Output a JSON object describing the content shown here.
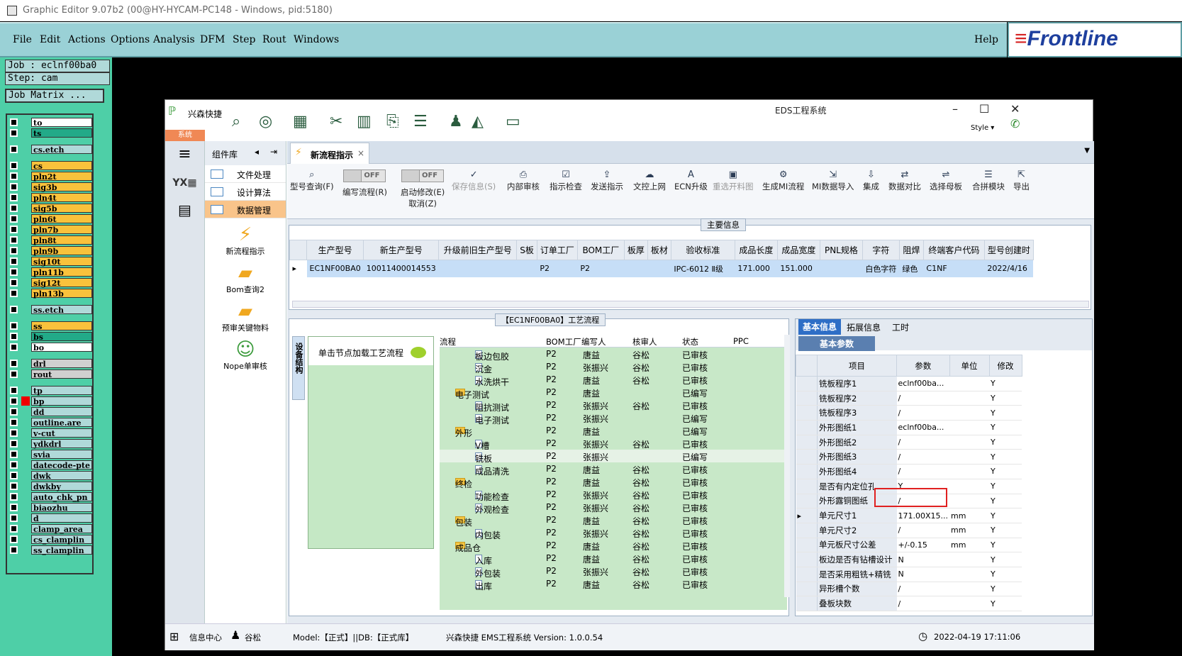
{
  "outer": {
    "title": "Graphic Editor 9.07b2 (00@HY-HYCAM-PC148 - Windows, pid:5180)",
    "menu": [
      "File",
      "Edit",
      "Actions",
      "Options",
      "Analysis",
      "DFM",
      "Step",
      "Rout",
      "Windows"
    ],
    "help": "Help",
    "logo": "Frontline",
    "job": "Job : eclnf00ba0",
    "step": "Step: cam",
    "job_matrix": "Job Matrix ...",
    "layers": [
      {
        "name": "to",
        "color": "#ffffff"
      },
      {
        "name": "ts",
        "color": "#22aa88"
      },
      {
        "name": "cs.etch",
        "color": "#b0d9d9"
      },
      {
        "name": "cs",
        "color": "#f9c23c"
      },
      {
        "name": "pln2t",
        "color": "#f9c23c"
      },
      {
        "name": "sig3b",
        "color": "#f9c23c"
      },
      {
        "name": "pln4t",
        "color": "#f9c23c"
      },
      {
        "name": "sig5b",
        "color": "#f9c23c"
      },
      {
        "name": "pln6t",
        "color": "#f9c23c"
      },
      {
        "name": "pln7b",
        "color": "#f9c23c"
      },
      {
        "name": "pln8t",
        "color": "#f9c23c"
      },
      {
        "name": "pln9b",
        "color": "#f9c23c"
      },
      {
        "name": "sig10t",
        "color": "#f9c23c"
      },
      {
        "name": "pln11b",
        "color": "#f9c23c"
      },
      {
        "name": "sig12t",
        "color": "#f9c23c"
      },
      {
        "name": "pln13b",
        "color": "#f9c23c"
      },
      {
        "name": "ss.etch",
        "color": "#b0d9d9"
      },
      {
        "name": "ss",
        "color": "#f9c23c"
      },
      {
        "name": "bs",
        "color": "#22aa88"
      },
      {
        "name": "bo",
        "color": "#ffffff"
      },
      {
        "name": "drl",
        "color": "#d0d0d0"
      },
      {
        "name": "rout",
        "color": "#d0d0d0"
      },
      {
        "name": "tp",
        "color": "#b0d9d9"
      },
      {
        "name": "bp",
        "color": "#b0d9d9"
      },
      {
        "name": "dd",
        "color": "#b0d9d9"
      },
      {
        "name": "outline.are",
        "color": "#b0d9d9"
      },
      {
        "name": "v-cut",
        "color": "#b0d9d9"
      },
      {
        "name": "ydkdrl",
        "color": "#b0d9d9"
      },
      {
        "name": "svia",
        "color": "#b0d9d9"
      },
      {
        "name": "datecode-pte",
        "color": "#b0d9d9"
      },
      {
        "name": "dwk",
        "color": "#b0d9d9"
      },
      {
        "name": "dwkby",
        "color": "#b0d9d9"
      },
      {
        "name": "auto_chk_pn",
        "color": "#b0d9d9"
      },
      {
        "name": "biaozhu",
        "color": "#b0d9d9"
      },
      {
        "name": "d",
        "color": "#b0d9d9"
      },
      {
        "name": "clamp_area",
        "color": "#b0d9d9"
      },
      {
        "name": "cs_clamplin",
        "color": "#b0d9d9"
      },
      {
        "name": "ss_clamplin",
        "color": "#b0d9d9"
      }
    ]
  },
  "win": {
    "title": "EDS工程系统",
    "brand": "兴森快捷",
    "sys_tab": "系统",
    "style": "Style ▾",
    "component_lib": "组件库",
    "comp_items": [
      "文件处理",
      "设计算法",
      "数据管理"
    ],
    "big_items": [
      "新流程指示",
      "Bom查询2",
      "预审关键物料",
      "Nope单审核"
    ],
    "tab": "新流程指示",
    "toolbar": [
      "型号查询(F)",
      "编写流程(R)",
      "启动修改(E)",
      "取消(Z)",
      "保存信息(S)",
      "内部审核",
      "指示检查",
      "发送指示",
      "文控上网",
      "ECN升级",
      "重选开料图",
      "生成MI流程",
      "MI数据导入",
      "集成",
      "数据对比",
      "选择母板",
      "合拼模块",
      "导出"
    ],
    "toggle_off": "OFF",
    "main_info": "主要信息",
    "top_headers": [
      "生产型号",
      "新生产型号",
      "升级前旧生产型号",
      "S板",
      "订单工厂",
      "BOM工厂",
      "板厚",
      "板材",
      "验收标准",
      "成品长度",
      "成品宽度",
      "PNL规格",
      "字符",
      "阻焊",
      "终端客户代码",
      "型号创建时"
    ],
    "top_row": [
      "EC1NF00BA0",
      "10011400014553",
      "",
      "",
      "P2",
      "P2",
      "",
      "",
      "IPC-6012 Ⅱ级",
      "171.000",
      "151.000",
      "",
      "白色字符",
      "绿色",
      "C1NF",
      "2022/4/16"
    ],
    "flow_caption": "【EC1NF00BA0】工艺流程",
    "vtab": "设备结构",
    "note_hd": "单击节点加载工艺流程",
    "tree_headers": [
      "流程",
      "BOM工厂",
      "编写人",
      "核审人",
      "状态",
      "PPC"
    ],
    "tree_rows": [
      {
        "n": "板边包胶",
        "l": 1,
        "f": "P2",
        "w": "唐益",
        "r": "谷松",
        "s": "已审核"
      },
      {
        "n": "沉金",
        "l": 1,
        "f": "P2",
        "w": "张振兴",
        "r": "谷松",
        "s": "已审核"
      },
      {
        "n": "水洗烘干",
        "l": 1,
        "f": "P2",
        "w": "唐益",
        "r": "谷松",
        "s": "已审核"
      },
      {
        "n": "电子测试",
        "l": 0,
        "f": "P2",
        "w": "唐益",
        "r": "",
        "s": "已编写"
      },
      {
        "n": "阻抗测试",
        "l": 1,
        "f": "P2",
        "w": "张振兴",
        "r": "谷松",
        "s": "已审核"
      },
      {
        "n": "电子测试",
        "l": 1,
        "f": "P2",
        "w": "张振兴",
        "r": "",
        "s": "已编写"
      },
      {
        "n": "外形",
        "l": 0,
        "f": "P2",
        "w": "唐益",
        "r": "",
        "s": "已编写"
      },
      {
        "n": "V槽",
        "l": 1,
        "f": "P2",
        "w": "张振兴",
        "r": "谷松",
        "s": "已审核"
      },
      {
        "n": "铣板",
        "l": 1,
        "f": "P2",
        "w": "张振兴",
        "r": "",
        "s": "已编写"
      },
      {
        "n": "成品清洗",
        "l": 1,
        "f": "P2",
        "w": "唐益",
        "r": "谷松",
        "s": "已审核"
      },
      {
        "n": "终检",
        "l": 0,
        "f": "P2",
        "w": "唐益",
        "r": "谷松",
        "s": "已审核"
      },
      {
        "n": "功能检查",
        "l": 1,
        "f": "P2",
        "w": "张振兴",
        "r": "谷松",
        "s": "已审核"
      },
      {
        "n": "外观检查",
        "l": 1,
        "f": "P2",
        "w": "张振兴",
        "r": "谷松",
        "s": "已审核"
      },
      {
        "n": "包装",
        "l": 0,
        "f": "P2",
        "w": "唐益",
        "r": "谷松",
        "s": "已审核"
      },
      {
        "n": "内包装",
        "l": 1,
        "f": "P2",
        "w": "张振兴",
        "r": "谷松",
        "s": "已审核"
      },
      {
        "n": "成品仓",
        "l": 0,
        "f": "P2",
        "w": "唐益",
        "r": "谷松",
        "s": "已审核"
      },
      {
        "n": "入库",
        "l": 1,
        "f": "P2",
        "w": "唐益",
        "r": "谷松",
        "s": "已审核"
      },
      {
        "n": "外包装",
        "l": 1,
        "f": "P2",
        "w": "张振兴",
        "r": "谷松",
        "s": "已审核"
      },
      {
        "n": "出库",
        "l": 1,
        "f": "P2",
        "w": "唐益",
        "r": "谷松",
        "s": "已审核"
      }
    ],
    "right_tabs": [
      "基本信息",
      "拓展信息",
      "工时"
    ],
    "basic_params": "基本参数",
    "param_headers": [
      "项目",
      "参数",
      "单位",
      "修改"
    ],
    "params": [
      [
        "铣板程序1",
        "eclnf00ba...",
        "",
        "Y"
      ],
      [
        "铣板程序2",
        "/",
        "",
        "Y"
      ],
      [
        "铣板程序3",
        "/",
        "",
        "Y"
      ],
      [
        "外形图纸1",
        "eclnf00ba...",
        "",
        "Y"
      ],
      [
        "外形图纸2",
        "/",
        "",
        "Y"
      ],
      [
        "外形图纸3",
        "/",
        "",
        "Y"
      ],
      [
        "外形图纸4",
        "/",
        "",
        "Y"
      ],
      [
        "是否有内定位孔",
        "Y",
        "",
        "Y"
      ],
      [
        "外形露铜图纸",
        "/",
        "",
        "Y"
      ],
      [
        "单元尺寸1",
        "171.00X15...",
        "mm",
        "Y"
      ],
      [
        "单元尺寸2",
        "/",
        "mm",
        "Y"
      ],
      [
        "单元板尺寸公差",
        "+/-0.15",
        "mm",
        "Y"
      ],
      [
        "板边是否有钻槽设计",
        "N",
        "",
        "Y"
      ],
      [
        "是否采用粗铣+精铣",
        "N",
        "",
        "Y"
      ],
      [
        "异形槽个数",
        "/",
        "",
        "Y"
      ],
      [
        "叠板块数",
        "/",
        "",
        "Y"
      ]
    ],
    "status": {
      "info": "信息中心",
      "user": "谷松",
      "model": "Model:【正式】||DB:【正式库】",
      "app": "兴森快捷 EMS工程系统 Version: 1.0.0.54",
      "time": "2022-04-19 17:11:06"
    }
  }
}
